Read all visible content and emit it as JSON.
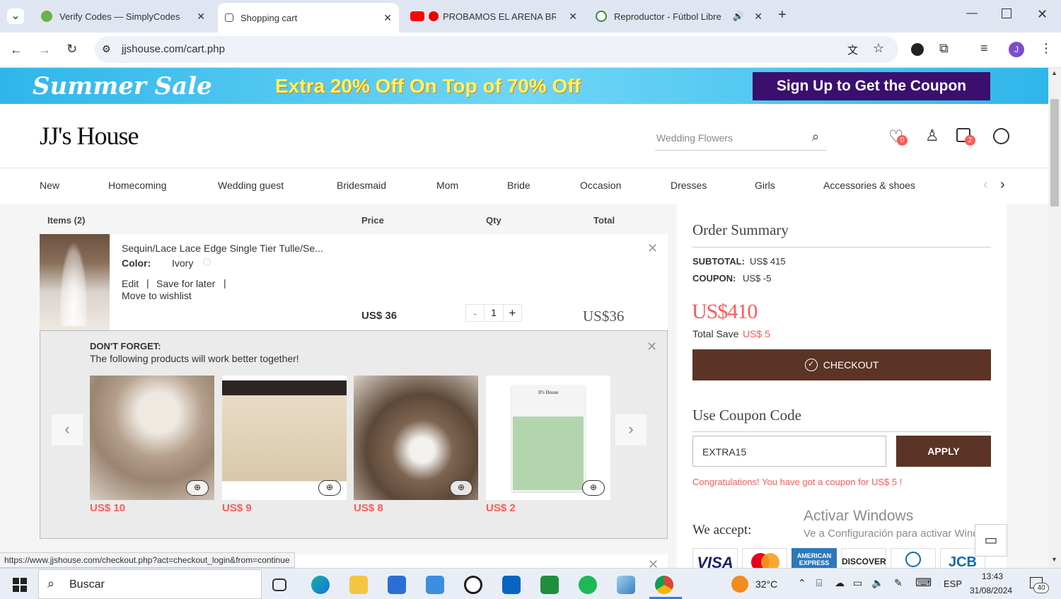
{
  "browser": {
    "tabs": [
      {
        "title": "Verify Codes — SimplyCodes",
        "color": "#6ab04c"
      },
      {
        "title": "Shopping cart",
        "color": "#555"
      },
      {
        "title": "PROBAMOS EL ARENA BRE",
        "color": "#ff0000"
      },
      {
        "title": "Reproductor - Fútbol Libre",
        "color": "#2f8f3a"
      }
    ],
    "url": "jjshouse.com/cart.php",
    "profile_initial": "J"
  },
  "banner": {
    "summer_sale": "Summer Sale",
    "offer": "Extra 20% Off On Top of 70% Off",
    "cta": "Sign Up to Get the Coupon"
  },
  "header": {
    "logo": "JJ's House",
    "search_placeholder": "Wedding Flowers",
    "wishlist_count": "0",
    "bag_count": "2"
  },
  "nav": [
    "New",
    "Homecoming",
    "Wedding guest",
    "Bridesmaid",
    "Mom",
    "Bride",
    "Occasion",
    "Dresses",
    "Girls",
    "Accessories & shoes"
  ],
  "cart": {
    "headers": {
      "items": "Items (2)",
      "price": "Price",
      "qty": "Qty",
      "total": "Total"
    },
    "item": {
      "name": "Sequin/Lace Lace Edge Single Tier Tulle/Se...",
      "color_label": "Color:",
      "color_value": "Ivory",
      "edit": "Edit",
      "save": "Save for later",
      "move": "Move to wishlist",
      "price": "US$ 36",
      "qty": "1",
      "qty_minus": "-",
      "qty_plus": "+",
      "total": "US$36"
    },
    "dont_forget": {
      "title": "DON'T FORGET:",
      "subtitle": "The following products will work better together!",
      "products": [
        {
          "price": "US$ 10"
        },
        {
          "price": "US$ 9"
        },
        {
          "price": "US$ 8"
        },
        {
          "price": "US$ 2",
          "swatch_label": "JJ's House"
        }
      ]
    }
  },
  "summary": {
    "title": "Order Summary",
    "subtotal_label": "SUBTOTAL:",
    "subtotal_value": "US$ 415",
    "coupon_label": "COUPON:",
    "coupon_value": "US$ -5",
    "total": "US$410",
    "save_label": "Total Save",
    "save_value": "US$ 5",
    "checkout": "CHECKOUT",
    "coupon_title": "Use Coupon Code",
    "coupon_code": "EXTRA15",
    "apply": "APPLY",
    "coupon_msg": "Congratulations! You have got a coupon for US$ 5 !",
    "we_accept": "We accept:",
    "cards": [
      "VISA",
      "",
      "AMERICAN EXPRESS",
      "DISCOVER",
      "",
      "JCB"
    ]
  },
  "status_url": "https://www.jjshouse.com/checkout.php?act=checkout_login&from=continue",
  "watermark": {
    "title": "Activar Windows",
    "subtitle": "Ve a Configuración para activar Windows."
  },
  "taskbar": {
    "search": "Buscar",
    "weather": "32°C",
    "lang": "ESP",
    "time": "13:43",
    "date": "31/08/2024",
    "notif": "40"
  },
  "colors": {
    "brand_brown": "#5b3426",
    "accent_red": "#ff5a5a",
    "banner_purple": "#3a0f6e"
  }
}
